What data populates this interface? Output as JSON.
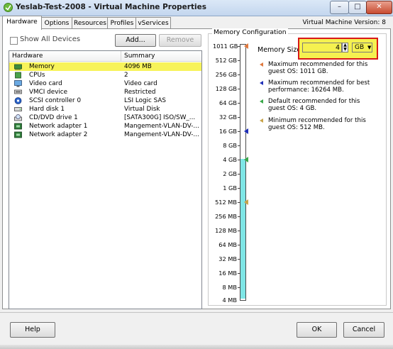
{
  "window": {
    "title": "Yeslab-Test-2008 - Virtual Machine Properties",
    "minimize_glyph": "–",
    "maximize_glyph": "□",
    "close_glyph": "✕"
  },
  "tabs": [
    {
      "label": "Hardware",
      "active": true
    },
    {
      "label": "Options",
      "active": false
    },
    {
      "label": "Resources",
      "active": false
    },
    {
      "label": "Profiles",
      "active": false
    },
    {
      "label": "vServices",
      "active": false
    }
  ],
  "vm_version": "Virtual Machine Version: 8",
  "hardware": {
    "show_all_devices_label": "Show All Devices",
    "show_all_devices_checked": false,
    "add_button": "Add...",
    "remove_button": "Remove",
    "columns": [
      "Hardware",
      "Summary"
    ],
    "rows": [
      {
        "icon": "memory-icon",
        "name": "Memory",
        "summary": "4096 MB",
        "selected": true
      },
      {
        "icon": "cpu-icon",
        "name": "CPUs",
        "summary": "2",
        "selected": false
      },
      {
        "icon": "monitor-icon",
        "name": "Video card",
        "summary": "Video card",
        "selected": false
      },
      {
        "icon": "vmci-icon",
        "name": "VMCI device",
        "summary": "Restricted",
        "selected": false
      },
      {
        "icon": "scsi-icon",
        "name": "SCSI controller 0",
        "summary": "LSI Logic SAS",
        "selected": false
      },
      {
        "icon": "harddisk-icon",
        "name": "Hard disk 1",
        "summary": "Virtual Disk",
        "selected": false
      },
      {
        "icon": "cdrom-icon",
        "name": "CD/DVD drive 1",
        "summary": "[SATA300G] ISO/SW_...",
        "selected": false
      },
      {
        "icon": "network-icon",
        "name": "Network adapter 1",
        "summary": "Mangement-VLAN-DV-...",
        "selected": false
      },
      {
        "icon": "network-icon",
        "name": "Network adapter 2",
        "summary": "Mangement-VLAN-DV-...",
        "selected": false
      }
    ]
  },
  "memory_config": {
    "group_label": "Memory Configuration",
    "scale_labels": [
      "1011 GB",
      "512 GB",
      "256 GB",
      "128 GB",
      "64 GB",
      "32 GB",
      "16 GB",
      "8 GB",
      "4 GB",
      "2 GB",
      "1 GB",
      "512 MB",
      "256 MB",
      "128 MB",
      "64 MB",
      "32 MB",
      "16 MB",
      "8 MB",
      "4 MB"
    ],
    "memory_size_label": "Memory Size:",
    "memory_value": "4",
    "unit": "GB",
    "unit_arrow": "▼",
    "spin_up": "▲",
    "spin_down": "▼",
    "legend": [
      {
        "color": "#e07a3f",
        "text": "Maximum recommended for this guest OS: 1011 GB."
      },
      {
        "color": "#1f2fb8",
        "text": "Maximum recommended for best performance: 16264 MB."
      },
      {
        "color": "#3aa84a",
        "text": "Default recommended for this guest OS: 4 GB."
      },
      {
        "color": "#c9a44a",
        "text": "Minimum recommended for this guest OS: 512 MB."
      }
    ]
  },
  "footer": {
    "help_button": "Help",
    "ok_button": "OK",
    "cancel_button": "Cancel"
  },
  "colors": {
    "selection_highlight": "#f7f35a",
    "annotation_box": "#d81818",
    "slider_fill": "#7ee6e6"
  }
}
